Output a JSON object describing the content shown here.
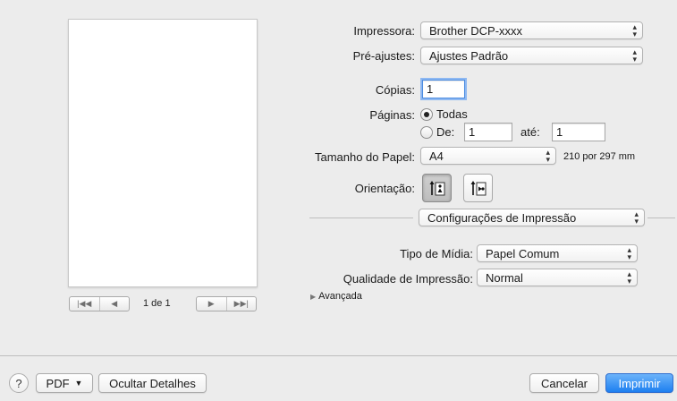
{
  "preview": {
    "page_indicator": "1 de 1",
    "nav_first_icon": "|◀◀",
    "nav_prev_icon": "◀",
    "nav_next_icon": "▶",
    "nav_last_icon": "▶▶|"
  },
  "printer": {
    "label": "Impressora:",
    "value": "Brother DCP-xxxx"
  },
  "presets": {
    "label": "Pré-ajustes:",
    "value": "Ajustes Padrão"
  },
  "copies": {
    "label": "Cópias:",
    "value": "1"
  },
  "pages": {
    "label": "Páginas:",
    "all_label": "Todas",
    "from_label": "De:",
    "from_value": "1",
    "to_label": "até:",
    "to_value": "1",
    "selected": "all"
  },
  "paper_size": {
    "label": "Tamanho do Papel:",
    "value": "A4",
    "dimensions": "210 por 297 mm"
  },
  "orientation": {
    "label": "Orientação:",
    "selected": "portrait"
  },
  "section_popup": {
    "value": "Configurações de Impressão"
  },
  "media_type": {
    "label": "Tipo de Mídia:",
    "value": "Papel Comum"
  },
  "print_quality": {
    "label": "Qualidade de Impressão:",
    "value": "Normal"
  },
  "advanced": {
    "label": "Avançada"
  },
  "footer": {
    "help": "?",
    "pdf": "PDF",
    "hide_details": "Ocultar Detalhes",
    "cancel": "Cancelar",
    "print": "Imprimir"
  },
  "colors": {
    "accent": "#1d7ff0",
    "background": "#ececec"
  }
}
